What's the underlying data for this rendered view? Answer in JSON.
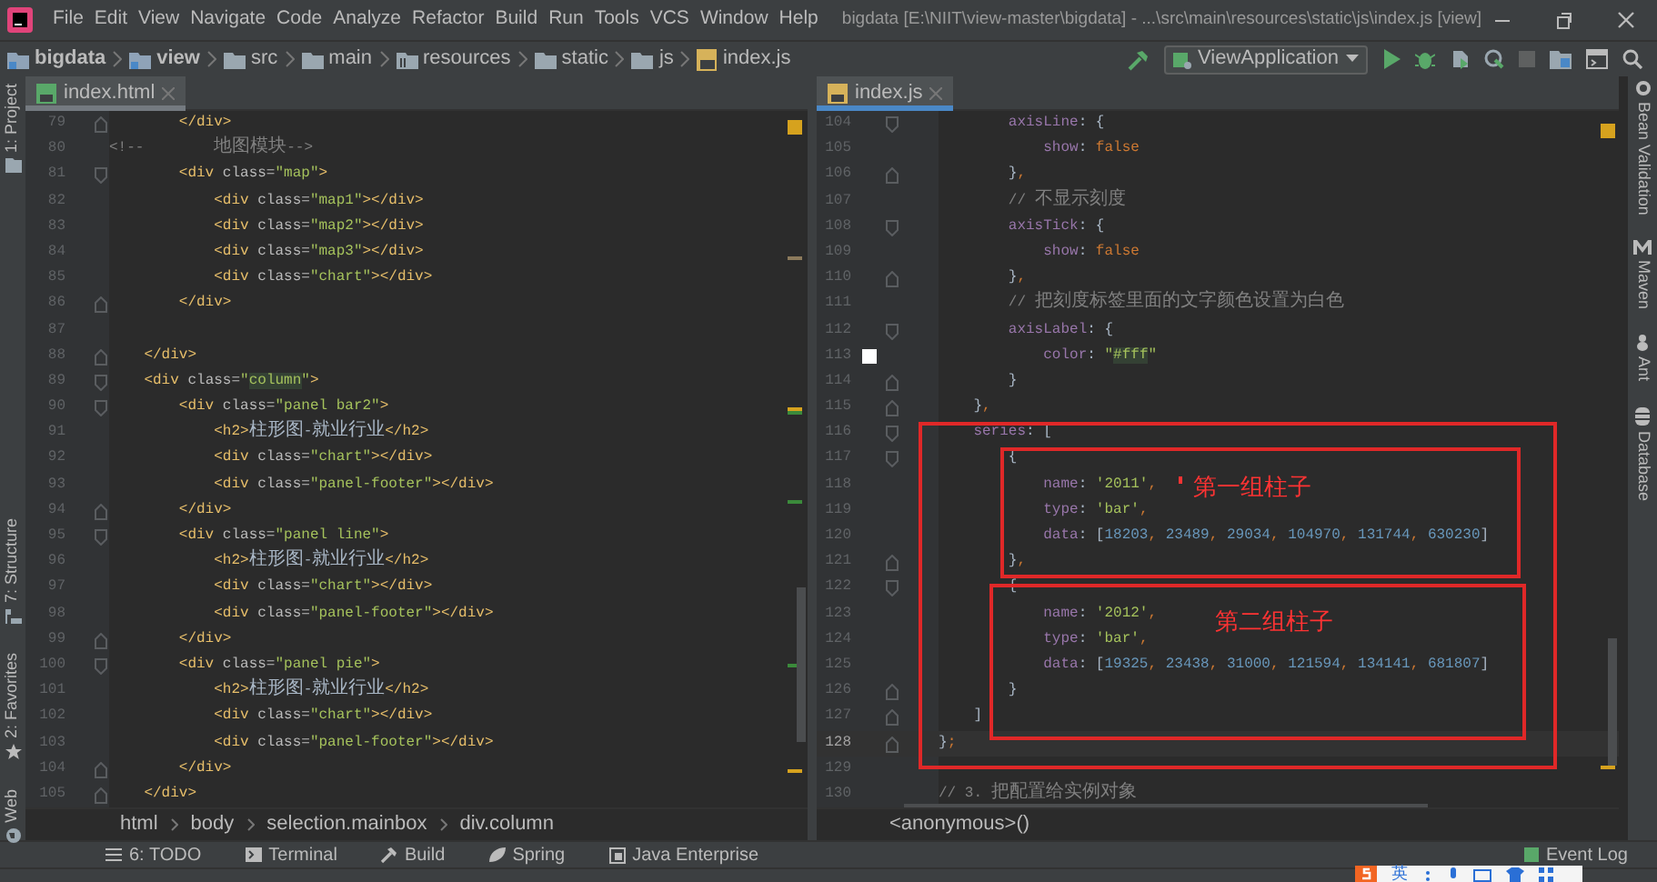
{
  "window": {
    "title": "bigdata [E:\\NIIT\\view-master\\bigdata] - ...\\src\\main\\resources\\static\\js\\index.js [view]"
  },
  "menu": [
    "File",
    "Edit",
    "View",
    "Navigate",
    "Code",
    "Analyze",
    "Refactor",
    "Build",
    "Run",
    "Tools",
    "VCS",
    "Window",
    "Help"
  ],
  "navbar": {
    "crumbs": [
      {
        "label": "bigdata",
        "kind": "project"
      },
      {
        "label": "view",
        "kind": "module"
      },
      {
        "label": "src",
        "kind": "folder"
      },
      {
        "label": "main",
        "kind": "folder"
      },
      {
        "label": "resources",
        "kind": "resources"
      },
      {
        "label": "static",
        "kind": "folder"
      },
      {
        "label": "js",
        "kind": "folder"
      },
      {
        "label": "index.js",
        "kind": "jsfile"
      }
    ],
    "run_config": "ViewApplication"
  },
  "left_tools": [
    "1: Project",
    "7: Structure",
    "2: Favorites",
    "Web"
  ],
  "right_tools": [
    "Bean Validation",
    "Maven",
    "Ant",
    "Database"
  ],
  "editors": [
    {
      "tab": {
        "label": "index.html",
        "kind": "html",
        "selected": false
      },
      "lines": [
        {
          "number": "79",
          "kind": "fold_end",
          "current": false,
          "tokens": [
            {
              "tag": "        </div>"
            }
          ]
        },
        {
          "number": "80",
          "kind": "plain",
          "current": false,
          "tokens": [
            {
              "comment": "<!--        地图模块-->"
            }
          ]
        },
        {
          "number": "81",
          "kind": "fold_start",
          "current": false,
          "tokens": [
            {
              "tag": "        <div "
            },
            {
              "attr": "class="
            },
            {
              "str": "\"map\""
            },
            {
              "tag": ">"
            }
          ]
        },
        {
          "number": "82",
          "kind": "plain",
          "current": false,
          "tokens": [
            {
              "tag": "            <div "
            },
            {
              "attr": "class="
            },
            {
              "str": "\"map1\""
            },
            {
              "tag": "></div>"
            }
          ]
        },
        {
          "number": "83",
          "kind": "plain",
          "current": false,
          "tokens": [
            {
              "tag": "            <div "
            },
            {
              "attr": "class="
            },
            {
              "str": "\"map2\""
            },
            {
              "tag": "></div>"
            }
          ]
        },
        {
          "number": "84",
          "kind": "plain",
          "current": false,
          "tokens": [
            {
              "tag": "            <div "
            },
            {
              "attr": "class="
            },
            {
              "str": "\"map3\""
            },
            {
              "tag": "></div>"
            }
          ]
        },
        {
          "number": "85",
          "kind": "plain",
          "current": false,
          "tokens": [
            {
              "tag": "            <div "
            },
            {
              "attr": "class="
            },
            {
              "str": "\"chart\""
            },
            {
              "tag": "></div>"
            }
          ]
        },
        {
          "number": "86",
          "kind": "fold_end",
          "current": false,
          "tokens": [
            {
              "tag": "        </div>"
            }
          ]
        },
        {
          "number": "87",
          "kind": "plain",
          "current": false
        },
        {
          "number": "88",
          "kind": "fold_end",
          "current": false,
          "tokens": [
            {
              "tag": "    </div>"
            }
          ]
        },
        {
          "number": "89",
          "kind": "fold_start",
          "current": false,
          "tokens": [
            {
              "tag": "    <div "
            },
            {
              "attr": "class="
            },
            {
              "str": "\""
            },
            {
              "match": "column"
            },
            {
              "str": "\""
            },
            {
              "tag": ">"
            }
          ]
        },
        {
          "number": "90",
          "kind": "fold_start",
          "current": false,
          "tokens": [
            {
              "tag": "        <div "
            },
            {
              "attr": "class="
            },
            {
              "str": "\"panel bar2\""
            },
            {
              "tag": ">"
            }
          ]
        },
        {
          "number": "91",
          "kind": "plain",
          "current": false,
          "tokens": [
            {
              "tag": "            <h2>"
            },
            {
              "plain": "柱形图-就业行业"
            },
            {
              "tag": "</h2>"
            }
          ]
        },
        {
          "number": "92",
          "kind": "plain",
          "current": false,
          "tokens": [
            {
              "tag": "            <div "
            },
            {
              "attr": "class="
            },
            {
              "str": "\"chart\""
            },
            {
              "tag": "></div>"
            }
          ]
        },
        {
          "number": "93",
          "kind": "plain",
          "current": false,
          "tokens": [
            {
              "tag": "            <div "
            },
            {
              "attr": "class="
            },
            {
              "str": "\"panel-footer\""
            },
            {
              "tag": "></div>"
            }
          ]
        },
        {
          "number": "94",
          "kind": "fold_end",
          "current": false,
          "tokens": [
            {
              "tag": "        </div>"
            }
          ]
        },
        {
          "number": "95",
          "kind": "fold_start",
          "current": false,
          "tokens": [
            {
              "tag": "        <div "
            },
            {
              "attr": "class="
            },
            {
              "str": "\"panel line\""
            },
            {
              "tag": ">"
            }
          ]
        },
        {
          "number": "96",
          "kind": "plain",
          "current": false,
          "tokens": [
            {
              "tag": "            <h2>"
            },
            {
              "plain": "柱形图-就业行业"
            },
            {
              "tag": "</h2>"
            }
          ]
        },
        {
          "number": "97",
          "kind": "plain",
          "current": false,
          "tokens": [
            {
              "tag": "            <div "
            },
            {
              "attr": "class="
            },
            {
              "str": "\"chart\""
            },
            {
              "tag": "></div>"
            }
          ]
        },
        {
          "number": "98",
          "kind": "plain",
          "current": false,
          "tokens": [
            {
              "tag": "            <div "
            },
            {
              "attr": "class="
            },
            {
              "str": "\"panel-footer\""
            },
            {
              "tag": "></div>"
            }
          ]
        },
        {
          "number": "99",
          "kind": "fold_end",
          "current": false,
          "tokens": [
            {
              "tag": "        </div>"
            }
          ]
        },
        {
          "number": "100",
          "kind": "fold_start",
          "current": false,
          "tokens": [
            {
              "tag": "        <div "
            },
            {
              "attr": "class="
            },
            {
              "str": "\"panel pie\""
            },
            {
              "tag": ">"
            }
          ]
        },
        {
          "number": "101",
          "kind": "plain",
          "current": false,
          "tokens": [
            {
              "tag": "            <h2>"
            },
            {
              "plain": "柱形图-就业行业"
            },
            {
              "tag": "</h2>"
            }
          ]
        },
        {
          "number": "102",
          "kind": "plain",
          "current": false,
          "tokens": [
            {
              "tag": "            <div "
            },
            {
              "attr": "class="
            },
            {
              "str": "\"chart\""
            },
            {
              "tag": "></div>"
            }
          ]
        },
        {
          "number": "103",
          "kind": "plain",
          "current": false,
          "tokens": [
            {
              "tag": "            <div "
            },
            {
              "attr": "class="
            },
            {
              "str": "\"panel-footer\""
            },
            {
              "tag": "></div>"
            }
          ]
        },
        {
          "number": "104",
          "kind": "fold_end",
          "current": false,
          "tokens": [
            {
              "tag": "        </div>"
            }
          ]
        },
        {
          "number": "105",
          "kind": "fold_end",
          "current": false,
          "tokens": [
            {
              "tag": "    </div>"
            }
          ]
        }
      ],
      "breadcrumb": [
        "html",
        "body",
        "selection.mainbox",
        "div.column"
      ]
    },
    {
      "tab": {
        "label": "index.js",
        "kind": "js",
        "selected": true
      },
      "lines": [
        {
          "number": "104",
          "kind": "fold_start",
          "current": false,
          "tokens": [
            {
              "key": "        axisLine"
            },
            {
              "plain": ": {"
            }
          ]
        },
        {
          "number": "105",
          "kind": "plain",
          "current": false,
          "tokens": [
            {
              "key": "            show"
            },
            {
              "plain": ": "
            },
            {
              "kw": "false"
            }
          ]
        },
        {
          "number": "106",
          "kind": "fold_end",
          "current": false,
          "tokens": [
            {
              "plain": "        }"
            },
            {
              "kw": ","
            }
          ]
        },
        {
          "number": "107",
          "kind": "plain",
          "current": false,
          "tokens": [
            {
              "comment": "        // 不显示刻度"
            }
          ]
        },
        {
          "number": "108",
          "kind": "fold_start",
          "current": false,
          "tokens": [
            {
              "key": "        axisTick"
            },
            {
              "plain": ": {"
            }
          ]
        },
        {
          "number": "109",
          "kind": "plain",
          "current": false,
          "tokens": [
            {
              "key": "            show"
            },
            {
              "plain": ": "
            },
            {
              "kw": "false"
            }
          ]
        },
        {
          "number": "110",
          "kind": "fold_end",
          "current": false,
          "tokens": [
            {
              "plain": "        }"
            },
            {
              "kw": ","
            }
          ]
        },
        {
          "number": "111",
          "kind": "plain",
          "current": false,
          "tokens": [
            {
              "comment": "        // 把刻度标签里面的文字颜色设置为白色"
            }
          ]
        },
        {
          "number": "112",
          "kind": "fold_start",
          "current": false,
          "tokens": [
            {
              "key": "        axisLabel"
            },
            {
              "plain": ": {"
            }
          ]
        },
        {
          "number": "113",
          "kind": "plain",
          "color": "#ffffff",
          "current": false,
          "tokens": [
            {
              "key": "            color"
            },
            {
              "plain": ": "
            },
            {
              "str": "\""
            },
            {
              "match": "#fff"
            },
            {
              "str": "\""
            }
          ]
        },
        {
          "number": "114",
          "kind": "fold_end",
          "current": false,
          "tokens": [
            {
              "plain": "        }"
            }
          ]
        },
        {
          "number": "115",
          "kind": "fold_end",
          "current": false,
          "tokens": [
            {
              "plain": "    }"
            },
            {
              "kw": ","
            }
          ]
        },
        {
          "number": "116",
          "kind": "fold_start",
          "current": false,
          "tokens": [
            {
              "key": "    series"
            },
            {
              "plain": ": ["
            }
          ]
        },
        {
          "number": "117",
          "kind": "fold_start",
          "current": false,
          "tokens": [
            {
              "plain": "        {"
            }
          ]
        },
        {
          "number": "118",
          "kind": "plain",
          "current": false,
          "tokens": [
            {
              "key": "            name"
            },
            {
              "plain": ": "
            },
            {
              "str": "'2011'"
            },
            {
              "kw": ","
            }
          ]
        },
        {
          "number": "119",
          "kind": "plain",
          "current": false,
          "tokens": [
            {
              "key": "            type"
            },
            {
              "plain": ": "
            },
            {
              "str": "'bar'"
            },
            {
              "kw": ","
            }
          ]
        },
        {
          "number": "120",
          "kind": "plain",
          "current": false,
          "tokens": [
            {
              "key": "            data"
            },
            {
              "plain": ": ["
            },
            {
              "num": "18203"
            },
            {
              "kw": ", "
            },
            {
              "num": "23489"
            },
            {
              "kw": ", "
            },
            {
              "num": "29034"
            },
            {
              "kw": ", "
            },
            {
              "num": "104970"
            },
            {
              "kw": ", "
            },
            {
              "num": "131744"
            },
            {
              "kw": ", "
            },
            {
              "num": "630230"
            },
            {
              "plain": "]"
            }
          ]
        },
        {
          "number": "121",
          "kind": "fold_end",
          "current": false,
          "tokens": [
            {
              "plain": "        }"
            },
            {
              "kw": ","
            }
          ]
        },
        {
          "number": "122",
          "kind": "fold_start",
          "current": false,
          "tokens": [
            {
              "plain": "        {"
            }
          ]
        },
        {
          "number": "123",
          "kind": "plain",
          "current": false,
          "tokens": [
            {
              "key": "            name"
            },
            {
              "plain": ": "
            },
            {
              "str": "'2012'"
            },
            {
              "kw": ","
            }
          ]
        },
        {
          "number": "124",
          "kind": "plain",
          "current": false,
          "tokens": [
            {
              "key": "            type"
            },
            {
              "plain": ": "
            },
            {
              "str": "'bar'"
            },
            {
              "kw": ","
            }
          ]
        },
        {
          "number": "125",
          "kind": "plain",
          "current": false,
          "tokens": [
            {
              "key": "            data"
            },
            {
              "plain": ": ["
            },
            {
              "num": "19325"
            },
            {
              "kw": ", "
            },
            {
              "num": "23438"
            },
            {
              "kw": ", "
            },
            {
              "num": "31000"
            },
            {
              "kw": ", "
            },
            {
              "num": "121594"
            },
            {
              "kw": ", "
            },
            {
              "num": "134141"
            },
            {
              "kw": ", "
            },
            {
              "num": "681807"
            },
            {
              "plain": "]"
            }
          ]
        },
        {
          "number": "126",
          "kind": "fold_end",
          "current": false,
          "tokens": [
            {
              "plain": "        }"
            }
          ]
        },
        {
          "number": "127",
          "kind": "fold_end",
          "current": false,
          "tokens": [
            {
              "plain": "    ]"
            }
          ]
        },
        {
          "number": "128",
          "kind": "fold_end",
          "current": true,
          "tokens": [
            {
              "plain": "}"
            },
            {
              "kw": ";"
            }
          ]
        },
        {
          "number": "129",
          "kind": "plain",
          "current": false
        },
        {
          "number": "130",
          "kind": "plain",
          "current": false,
          "tokens": [
            {
              "comment": "// 3. 把配置给实例对象"
            }
          ]
        }
      ],
      "breadcrumb": [
        "<anonymous>()"
      ]
    }
  ],
  "annotations": [
    {
      "label": "第一组柱子"
    },
    {
      "label": "第二组柱子"
    }
  ],
  "tool_windows": [
    {
      "label": "6: TODO",
      "kind": "todo"
    },
    {
      "label": "Terminal",
      "kind": "terminal"
    },
    {
      "label": "Build",
      "kind": "build"
    },
    {
      "label": "Spring",
      "kind": "spring"
    },
    {
      "label": "Java Enterprise",
      "kind": "javaee"
    }
  ],
  "event_log": "Event Log",
  "ime": {
    "label": "英"
  }
}
